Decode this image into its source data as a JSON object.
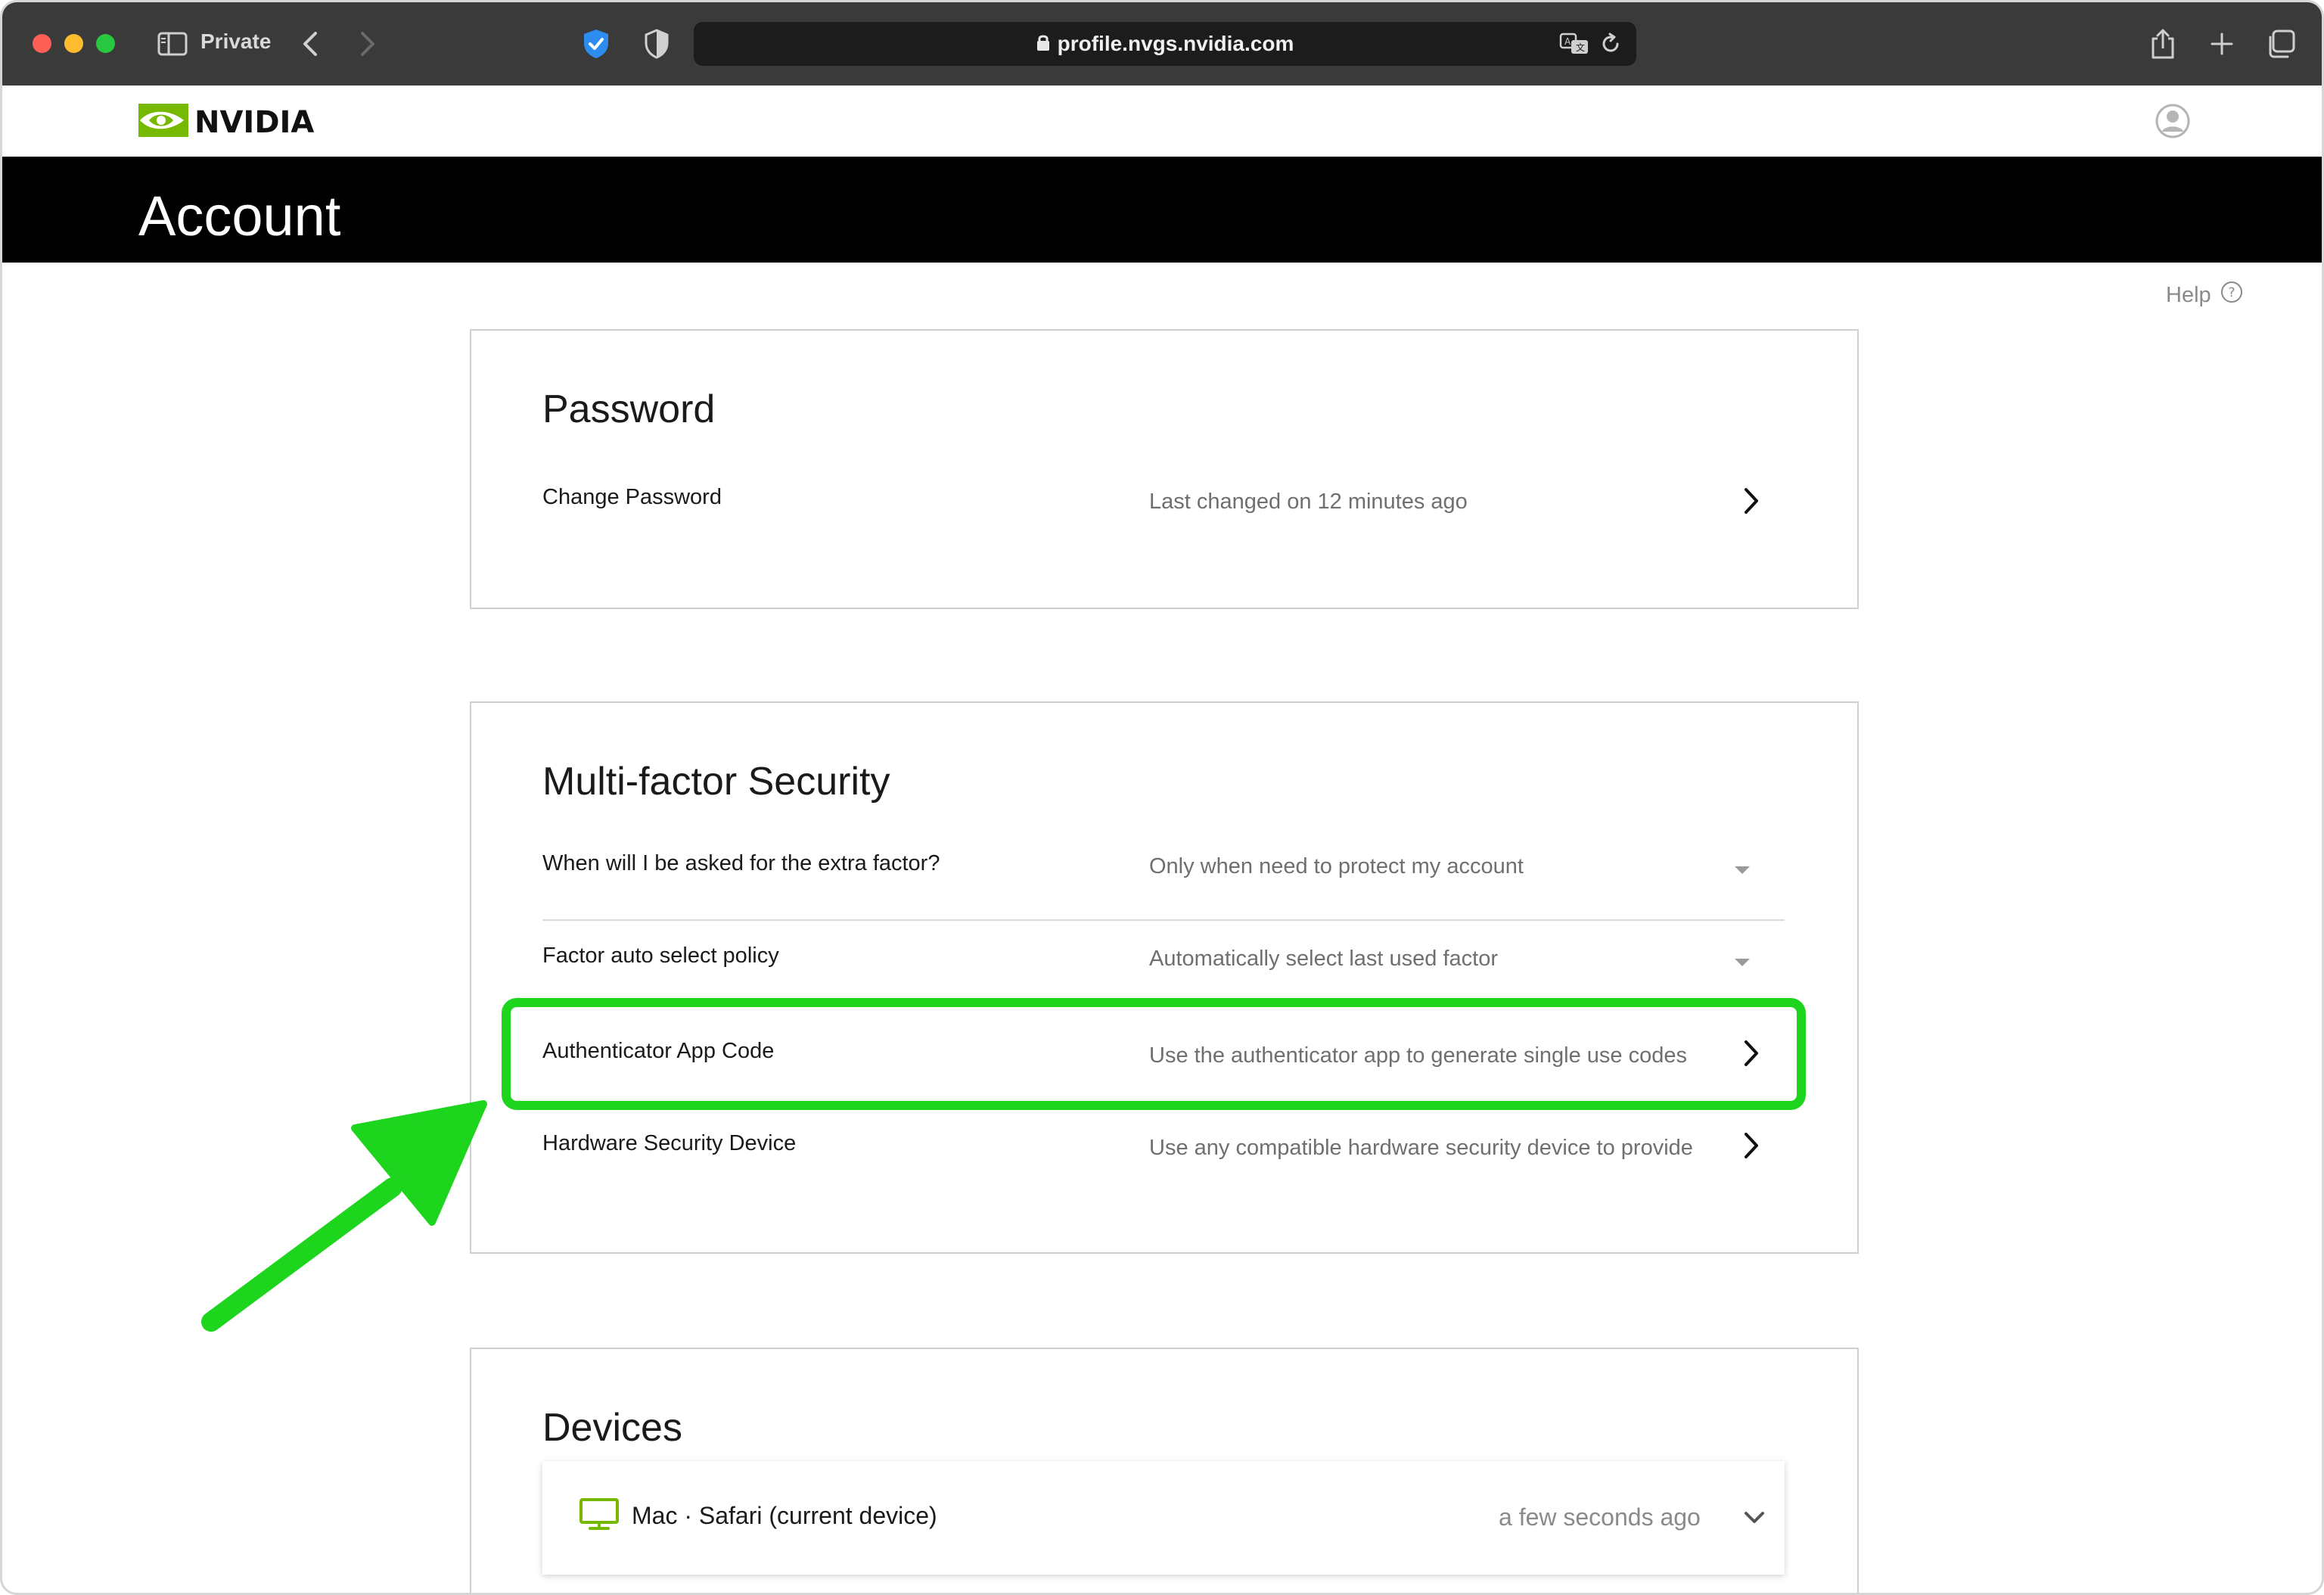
{
  "browser": {
    "window_mode": "Private",
    "url": "profile.nvgs.nvidia.com",
    "icons": [
      "sidebar-icon",
      "back-icon",
      "forward-icon",
      "privacy-shield-icon",
      "shield-icon",
      "lock-icon",
      "translate-icon",
      "reload-icon",
      "share-icon",
      "new-tab-icon",
      "tab-overview-icon"
    ]
  },
  "header": {
    "brand": "NVIDIA",
    "page_title": "Account",
    "help_label": "Help"
  },
  "password": {
    "title": "Password",
    "change_label": "Change Password",
    "change_value": "Last changed on 12 minutes ago"
  },
  "mfa": {
    "title": "Multi-factor Security",
    "rows": [
      {
        "label": "When will I be asked for the extra factor?",
        "value": "Only when need to protect my account",
        "control": "dropdown"
      },
      {
        "label": "Factor auto select policy",
        "value": "Automatically select last used factor",
        "control": "dropdown"
      },
      {
        "label": "Authenticator App Code",
        "value": "Use the authenticator app to generate single use codes",
        "control": "chevron"
      },
      {
        "label": "Hardware Security Device",
        "value": "Use any compatible hardware security device to provide",
        "control": "chevron"
      }
    ]
  },
  "devices": {
    "title": "Devices",
    "items": [
      {
        "name": "Mac · Safari (current device)",
        "last_seen": "a few seconds ago"
      }
    ]
  },
  "colors": {
    "nvidia_green": "#76b900",
    "highlight_green": "#1ed51e",
    "banner_black": "#000000"
  }
}
